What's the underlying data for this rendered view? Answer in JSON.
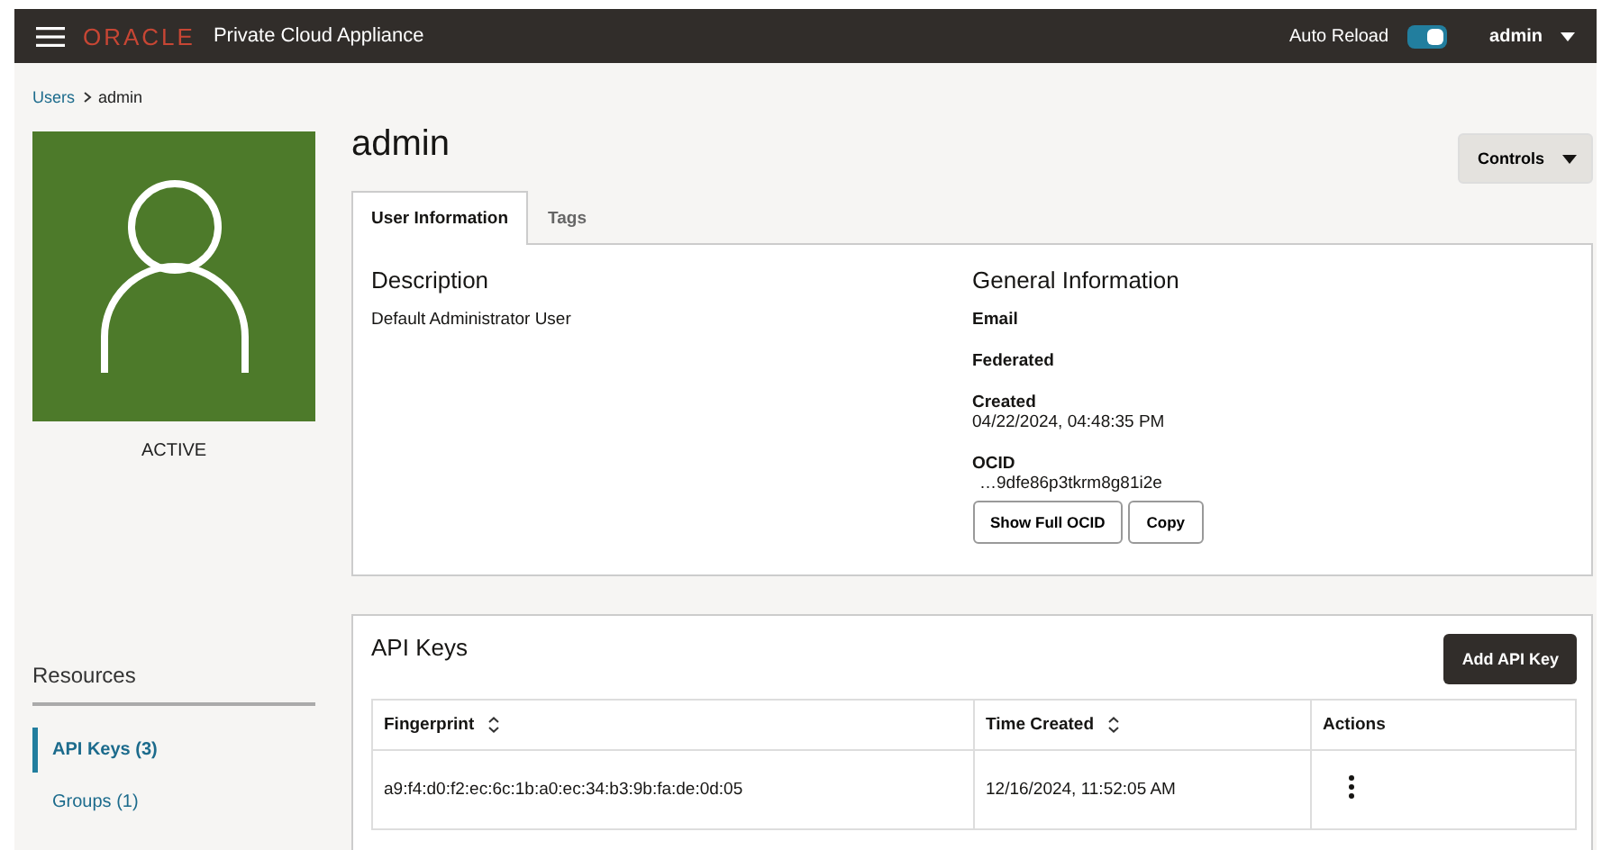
{
  "header": {
    "logo": "ORACLE",
    "product": "Private Cloud Appliance",
    "auto_reload": {
      "label": "Auto Reload",
      "on": true
    },
    "user": "admin"
  },
  "breadcrumb": [
    {
      "label": "Users",
      "link": true
    },
    {
      "label": "admin",
      "link": false
    }
  ],
  "user": {
    "status": "ACTIVE",
    "name": "admin"
  },
  "controls_button": "Controls",
  "tabs": [
    {
      "label": "User Information",
      "selected": true
    },
    {
      "label": "Tags",
      "selected": false
    }
  ],
  "description": {
    "heading": "Description",
    "text": "Default Administrator User"
  },
  "general": {
    "heading": "General Information",
    "fields": [
      {
        "label": "Email"
      },
      {
        "label": "Federated"
      },
      {
        "label": "Created",
        "value": "04/22/2024, 04:48:35 PM"
      },
      {
        "label": "OCID",
        "value": "…9dfe86p3tkrm8g81i2e"
      }
    ],
    "buttons": [
      "Show Full OCID",
      "Copy"
    ]
  },
  "resources": {
    "title": "Resources",
    "items": [
      {
        "label": "API Keys (3)",
        "selected": true
      },
      {
        "label": "Groups (1)",
        "selected": false
      }
    ]
  },
  "api_keys": {
    "title": "API Keys",
    "add_button": "Add API Key",
    "columns": [
      {
        "label": "Fingerprint",
        "sortable": true
      },
      {
        "label": "Time Created",
        "sortable": true
      },
      {
        "label": "Actions",
        "sortable": false
      }
    ],
    "rows": [
      {
        "fingerprint": "a9:f4:d0:f2:ec:6c:1b:a0:ec:34:b3:9b:fa:de:0d:05",
        "time_created": "12/16/2024, 11:52:05 AM"
      }
    ]
  }
}
